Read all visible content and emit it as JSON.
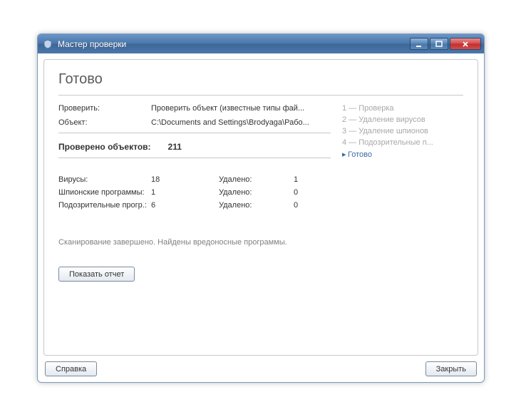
{
  "window": {
    "title": "Мастер проверки"
  },
  "page": {
    "heading": "Готово",
    "check_label": "Проверить:",
    "check_value": "Проверить объект (известные типы фай...",
    "object_label": "Объект:",
    "object_value": "C:\\Documents and Settings\\Brodyaga\\Рабо...",
    "scanned_label": "Проверено объектов:",
    "scanned_value": "211",
    "status_message": "Сканирование завершено. Найдены вредоносные программы.",
    "show_report": "Показать отчет"
  },
  "stats": {
    "deleted_label": "Удалено:",
    "rows": [
      {
        "name": "Вирусы:",
        "count": "18",
        "deleted": "1"
      },
      {
        "name": "Шпионские программы:",
        "count": "1",
        "deleted": "0"
      },
      {
        "name": "Подозрительные прогр.:",
        "count": "6",
        "deleted": "0"
      }
    ]
  },
  "steps": [
    {
      "label": "1 — Проверка"
    },
    {
      "label": "2 — Удаление вирусов"
    },
    {
      "label": "3 — Удаление шпионов"
    },
    {
      "label": "4 — Подозрительные п..."
    },
    {
      "label": "Готово",
      "active": true
    }
  ],
  "footer": {
    "help": "Справка",
    "close": "Закрыть"
  }
}
